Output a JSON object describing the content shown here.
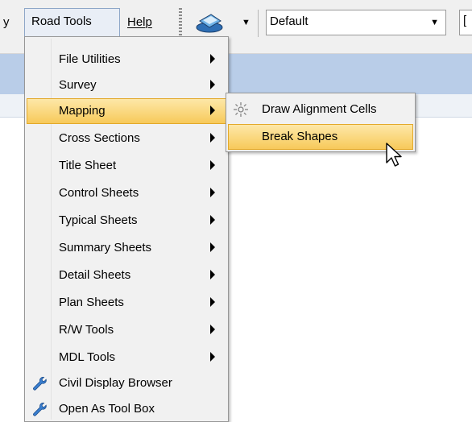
{
  "menubar": {
    "left_partial": "y",
    "road_tools": "Road Tools",
    "help": "Help",
    "level_combo_value": "Default",
    "next_combo_partial": "["
  },
  "road_tools_menu": {
    "items": [
      {
        "label": "File Utilities",
        "submenu": true,
        "icon": ""
      },
      {
        "label": "Survey",
        "submenu": true,
        "icon": ""
      },
      {
        "label": "Mapping",
        "submenu": true,
        "icon": "",
        "highlighted": true
      },
      {
        "label": "Cross Sections",
        "submenu": true,
        "icon": ""
      },
      {
        "label": "Title Sheet",
        "submenu": true,
        "icon": ""
      },
      {
        "label": "Control Sheets",
        "submenu": true,
        "icon": ""
      },
      {
        "label": "Typical Sheets",
        "submenu": true,
        "icon": ""
      },
      {
        "label": "Summary Sheets",
        "submenu": true,
        "icon": ""
      },
      {
        "label": "Detail Sheets",
        "submenu": true,
        "icon": ""
      },
      {
        "label": "Plan Sheets",
        "submenu": true,
        "icon": ""
      },
      {
        "label": "R/W Tools",
        "submenu": true,
        "icon": ""
      },
      {
        "label": "MDL Tools",
        "submenu": true,
        "icon": ""
      },
      {
        "label": "Civil Display Browser",
        "submenu": false,
        "icon": "wrench-icon"
      },
      {
        "label": "Open As Tool Box",
        "submenu": false,
        "icon": "wrench-icon"
      }
    ]
  },
  "mapping_submenu": {
    "items": [
      {
        "label": "Draw Alignment Cells",
        "icon": "sun-icon"
      },
      {
        "label": "Break Shapes",
        "icon": "",
        "highlighted": true
      }
    ]
  },
  "colors": {
    "highlight_top": "#fde8a8",
    "highlight_bottom": "#f7c95a",
    "highlight_border": "#e3a92a",
    "menu_bg": "#f1f1f1",
    "band_blue": "#b9cde8"
  }
}
